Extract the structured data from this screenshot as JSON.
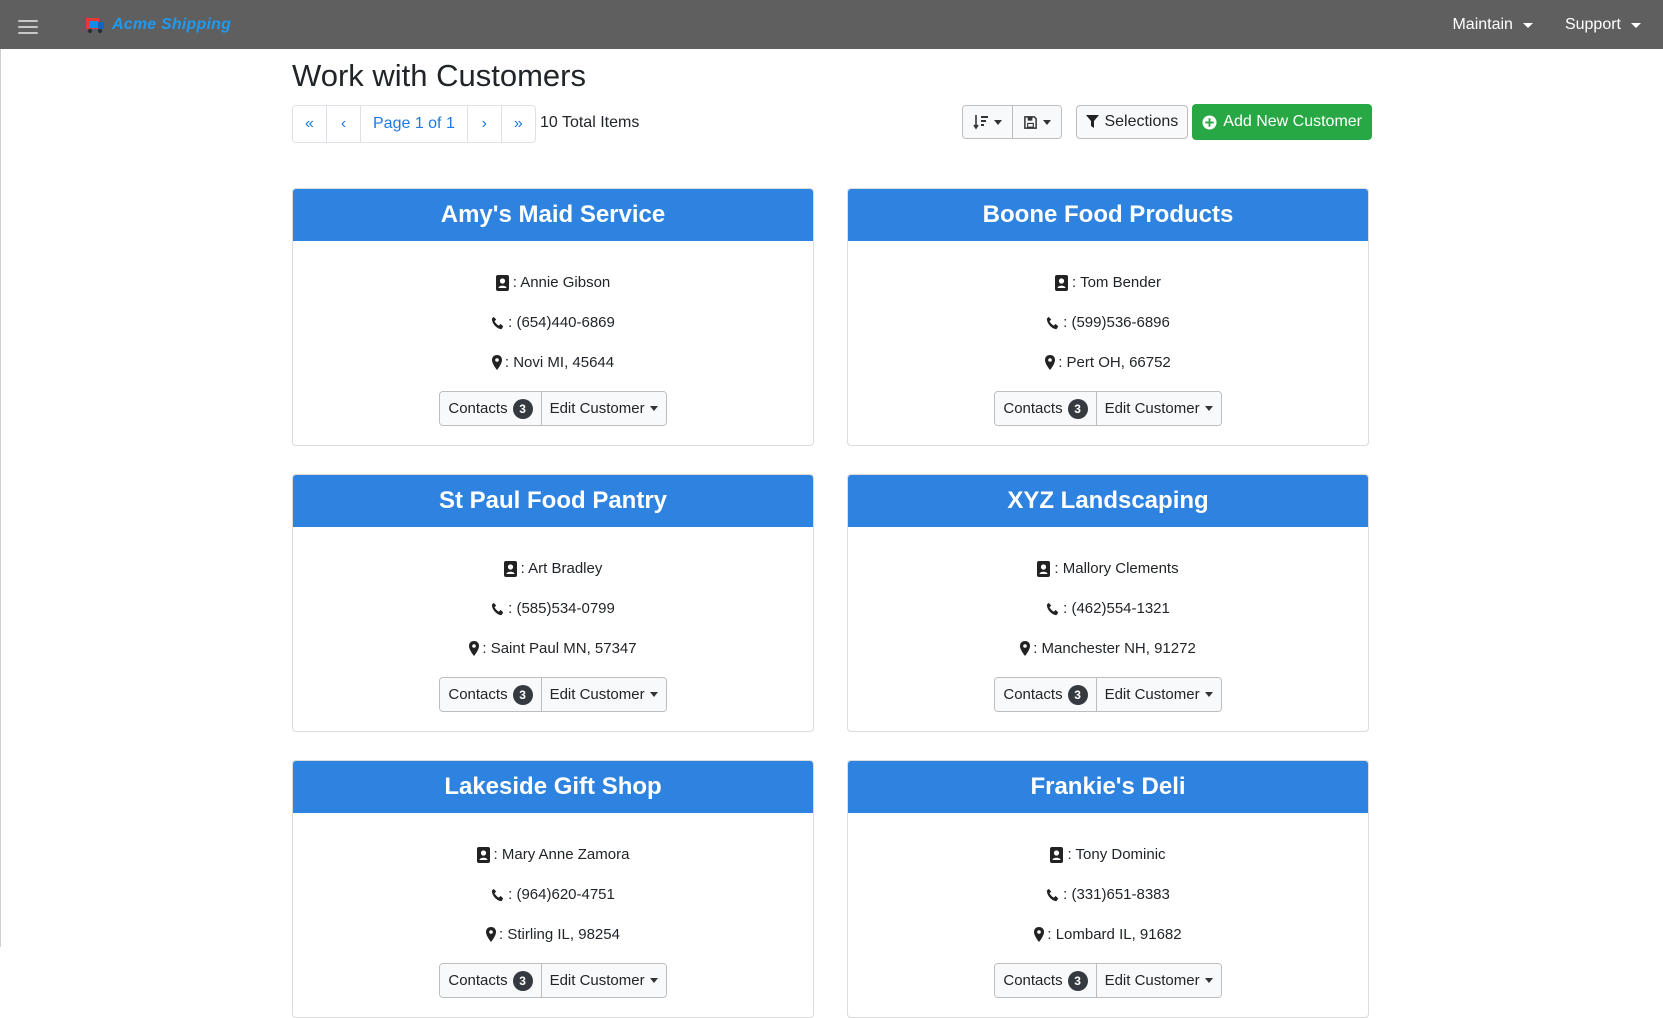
{
  "nav": {
    "brand": "Acme Shipping",
    "menu": [
      {
        "label": "Maintain"
      },
      {
        "label": "Support"
      }
    ]
  },
  "page": {
    "title": "Work with Customers",
    "pager": {
      "label": "Page 1 of 1",
      "first": "«",
      "prev": "‹",
      "next": "›",
      "last": "»"
    },
    "total": "10 Total Items"
  },
  "toolbar": {
    "selections_label": "Selections",
    "add_label": "Add New Customer"
  },
  "colors": {
    "header": "#2f83e0",
    "add_button": "#28a745",
    "topbar": "#5f5f5f"
  },
  "customers": [
    {
      "name": "Amy's Maid Service",
      "contact": ": Annie Gibson",
      "phone": ": (654)440-6869",
      "address": ":  Novi MI, 45644",
      "contacts_label": "Contacts",
      "contacts_count": "3",
      "edit_label": "Edit Customer"
    },
    {
      "name": "Boone Food Products",
      "contact": ": Tom Bender",
      "phone": ": (599)536-6896",
      "address": ":  Pert OH, 66752",
      "contacts_label": "Contacts",
      "contacts_count": "3",
      "edit_label": "Edit Customer"
    },
    {
      "name": "St Paul Food Pantry",
      "contact": ": Art Bradley",
      "phone": ": (585)534-0799",
      "address": ":  Saint Paul MN, 57347",
      "contacts_label": "Contacts",
      "contacts_count": "3",
      "edit_label": "Edit Customer"
    },
    {
      "name": "XYZ Landscaping",
      "contact": ": Mallory Clements",
      "phone": ": (462)554-1321",
      "address": ":  Manchester NH, 91272",
      "contacts_label": "Contacts",
      "contacts_count": "3",
      "edit_label": "Edit Customer"
    },
    {
      "name": "Lakeside Gift Shop",
      "contact": ": Mary Anne Zamora",
      "phone": ": (964)620-4751",
      "address": ":  Stirling IL, 98254",
      "contacts_label": "Contacts",
      "contacts_count": "3",
      "edit_label": "Edit Customer"
    },
    {
      "name": "Frankie's Deli",
      "contact": ": Tony Dominic",
      "phone": ": (331)651-8383",
      "address": ":  Lombard IL, 91682",
      "contacts_label": "Contacts",
      "contacts_count": "3",
      "edit_label": "Edit Customer"
    }
  ]
}
